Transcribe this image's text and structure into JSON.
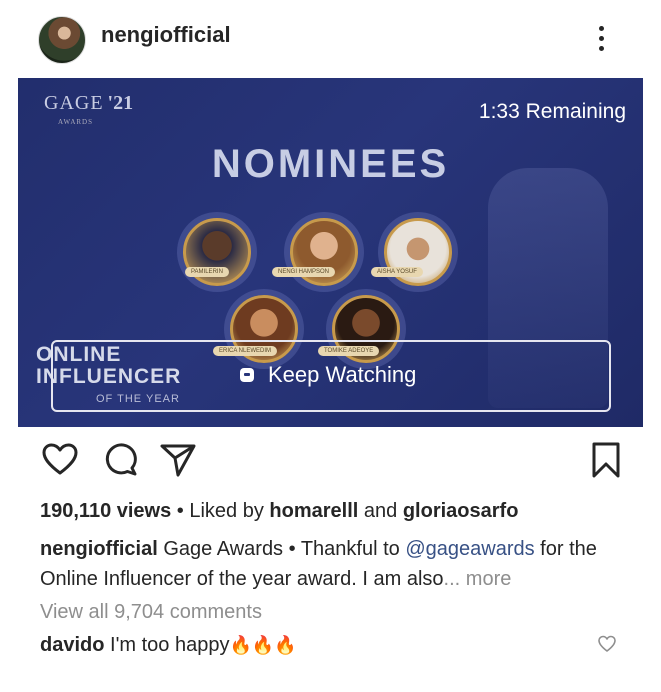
{
  "post": {
    "username": "nengiofficial",
    "more_icon": "more-vertical-icon"
  },
  "video": {
    "logo_name": "GAGE",
    "logo_year": "'21",
    "logo_sub": "AWARDS",
    "remaining": "1:33 Remaining",
    "heading": "NOMINEES",
    "category_line1": "ONLINE",
    "category_line2": "INFLUENCER",
    "category_line3": "OF THE YEAR",
    "keep_watching": "Keep Watching",
    "background_color": "#26337a",
    "nominee_labels": [
      "PAMILERIN",
      "NENGI HAMPSON",
      "AISHA YOSUF",
      "ERICA NLEWEDIM",
      "TOMIKE ADEOYE"
    ]
  },
  "actions": {
    "like_icon": "heart-icon",
    "comment_icon": "comment-icon",
    "share_icon": "send-icon",
    "save_icon": "bookmark-icon"
  },
  "stats": {
    "views": "190,110 views",
    "separator": " • ",
    "liked_by": "Liked by ",
    "liker1": "homarelll",
    "and": " and ",
    "liker2": "gloriaosarfo"
  },
  "caption": {
    "username": "nengiofficial",
    "text1": " Gage Awards • Thankful to ",
    "mention": "@gageawards",
    "text2": " for the Online Influencer of the year award. I am also",
    "ellipsis": "... ",
    "more": "more"
  },
  "comments": {
    "view_all": "View all 9,704 comments",
    "first_user": "davido",
    "first_text": " I'm too happy",
    "first_emoji": "🔥🔥🔥"
  }
}
